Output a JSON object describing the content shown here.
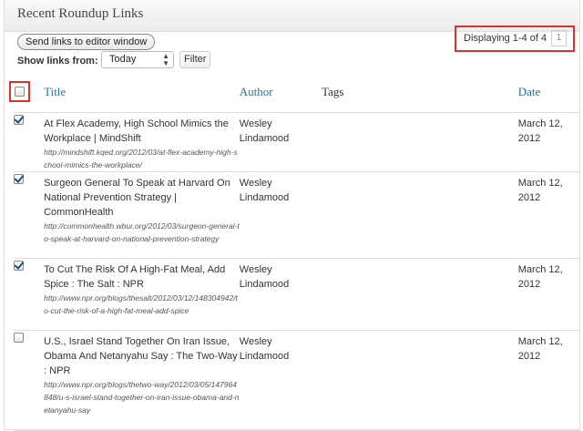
{
  "panel": {
    "title": "Recent Roundup Links",
    "send_button_label": "Send links to editor window",
    "show_links_label": "Show links from:",
    "filter_select_value": "Today",
    "filter_button_label": "Filter",
    "displaying_text": "Displaying 1-4 of 4",
    "current_page": "1"
  },
  "table": {
    "headers": {
      "title": "Title",
      "author": "Author",
      "tags": "Tags",
      "date": "Date"
    },
    "rows": [
      {
        "checked": true,
        "title": "At Flex Academy, High School Mimics the Workplace | MindShift",
        "url": "http://mindshift.kqed.org/2012/03/at-flex-academy-high-school-mimics-the-workplace/",
        "author": "Wesley Lindamood",
        "tags": "",
        "date": "March 12, 2012"
      },
      {
        "checked": true,
        "title": "Surgeon General To Speak at Harvard On National Prevention Strategy | CommonHealth",
        "url": "http://commonhealth.wbur.org/2012/03/surgeon-general-to-speak-at-harvard-on-national-prevention-strategy",
        "author": "Wesley Lindamood",
        "tags": "",
        "date": "March 12, 2012"
      },
      {
        "checked": true,
        "title": "To Cut The Risk Of A High-Fat Meal, Add Spice : The Salt : NPR",
        "url": "http://www.npr.org/blogs/thesalt/2012/03/12/148304942/to-cut-the-risk-of-a-high-fat-meal-add-spice",
        "author": "Wesley Lindamood",
        "tags": "",
        "date": "March 12, 2012"
      },
      {
        "checked": false,
        "title": "U.S., Israel Stand Together On Iran Issue, Obama And Netanyahu Say : The Two-Way : NPR",
        "url": "http://www.npr.org/blogs/thetwo-way/2012/03/05/147964848/u-s-israel-stand-together-on-iran-issue-obama-and-netanyahu-say",
        "author": "Wesley Lindamood",
        "tags": "",
        "date": "March 12, 2012"
      }
    ]
  },
  "colors": {
    "link": "#21759b",
    "highlight_border": "#d9342b",
    "check": "#1e4d8c"
  }
}
